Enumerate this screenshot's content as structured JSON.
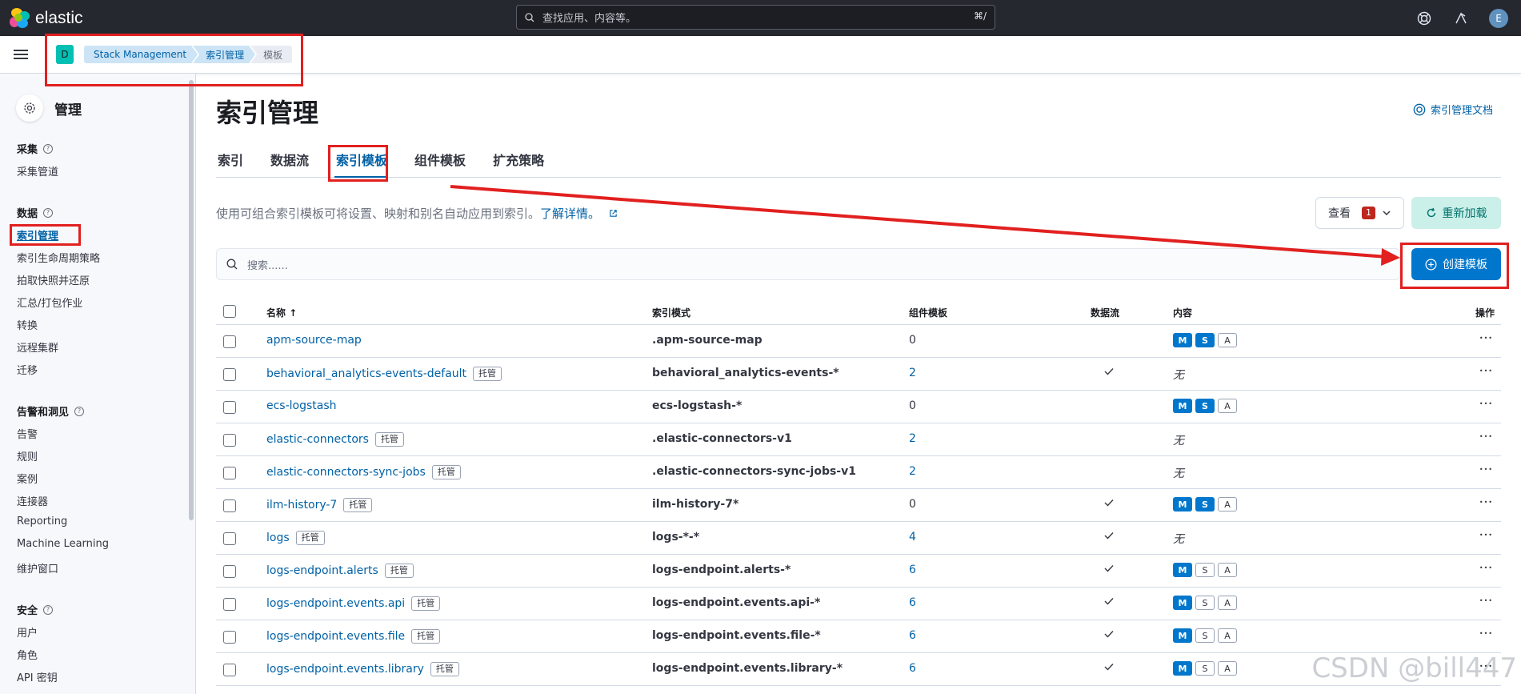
{
  "topbar": {
    "brand": "elastic",
    "search_placeholder": "查找应用、内容等。",
    "search_shortcut": "⌘/",
    "avatar": "E"
  },
  "breadcrumbs": {
    "space": "D",
    "items": [
      "Stack Management",
      "索引管理",
      "模板"
    ]
  },
  "sidebar": {
    "title": "管理",
    "groups": [
      {
        "label": "采集",
        "items": [
          "采集管道"
        ]
      },
      {
        "label": "数据",
        "items": [
          "索引管理",
          "索引生命周期策略",
          "拍取快照并还原",
          "汇总/打包作业",
          "转换",
          "远程集群",
          "迁移"
        ]
      },
      {
        "label": "告警和洞见",
        "items": [
          "告警",
          "规则",
          "案例",
          "连接器",
          "Reporting",
          "Machine Learning",
          "维护窗口"
        ]
      },
      {
        "label": "安全",
        "items": [
          "用户",
          "角色",
          "API 密钥"
        ]
      }
    ],
    "active": "索引管理"
  },
  "main": {
    "title": "索引管理",
    "doc_link": "索引管理文档",
    "tabs": [
      "索引",
      "数据流",
      "索引模板",
      "组件模板",
      "扩充策略"
    ],
    "active_tab": "索引模板",
    "description": "使用可组合索引模板可将设置、映射和别名自动应用到索引。",
    "learn_more": "了解详情。",
    "view_label": "查看",
    "view_count": "1",
    "reload_label": "重新加载",
    "search_placeholder": "搜索......",
    "create_label": "创建模板"
  },
  "table": {
    "headers": [
      "名称",
      "索引模式",
      "组件模板",
      "数据流",
      "内容",
      "操作"
    ],
    "managed_label": "托管",
    "none_label": "无",
    "rows": [
      {
        "name": "apm-source-map",
        "managed": false,
        "pattern": ".apm-source-map",
        "components": "0",
        "datastream": false,
        "content": [
          "M",
          "S",
          "A"
        ],
        "on": [
          true,
          true,
          false
        ]
      },
      {
        "name": "behavioral_analytics-events-default",
        "managed": true,
        "pattern": "behavioral_analytics-events-*",
        "components": "2",
        "datastream": true,
        "content": null
      },
      {
        "name": "ecs-logstash",
        "managed": false,
        "pattern": "ecs-logstash-*",
        "components": "0",
        "datastream": false,
        "content": [
          "M",
          "S",
          "A"
        ],
        "on": [
          true,
          true,
          false
        ]
      },
      {
        "name": "elastic-connectors",
        "managed": true,
        "pattern": ".elastic-connectors-v1",
        "components": "2",
        "datastream": false,
        "content": null
      },
      {
        "name": "elastic-connectors-sync-jobs",
        "managed": true,
        "pattern": ".elastic-connectors-sync-jobs-v1",
        "components": "2",
        "datastream": false,
        "content": null
      },
      {
        "name": "ilm-history-7",
        "managed": true,
        "pattern": "ilm-history-7*",
        "components": "0",
        "datastream": true,
        "content": [
          "M",
          "S",
          "A"
        ],
        "on": [
          true,
          true,
          false
        ]
      },
      {
        "name": "logs",
        "managed": true,
        "pattern": "logs-*-*",
        "components": "4",
        "datastream": true,
        "content": null
      },
      {
        "name": "logs-endpoint.alerts",
        "managed": true,
        "pattern": "logs-endpoint.alerts-*",
        "components": "6",
        "datastream": true,
        "content": [
          "M",
          "S",
          "A"
        ],
        "on": [
          true,
          false,
          false
        ]
      },
      {
        "name": "logs-endpoint.events.api",
        "managed": true,
        "pattern": "logs-endpoint.events.api-*",
        "components": "6",
        "datastream": true,
        "content": [
          "M",
          "S",
          "A"
        ],
        "on": [
          true,
          false,
          false
        ]
      },
      {
        "name": "logs-endpoint.events.file",
        "managed": true,
        "pattern": "logs-endpoint.events.file-*",
        "components": "6",
        "datastream": true,
        "content": [
          "M",
          "S",
          "A"
        ],
        "on": [
          true,
          false,
          false
        ]
      },
      {
        "name": "logs-endpoint.events.library",
        "managed": true,
        "pattern": "logs-endpoint.events.library-*",
        "components": "6",
        "datastream": true,
        "content": [
          "M",
          "S",
          "A"
        ],
        "on": [
          true,
          false,
          false
        ]
      }
    ]
  },
  "watermark": "CSDN @bill447",
  "colors": {
    "accent": "#0077cc",
    "link": "#0061a6",
    "annotation": "#e1201f",
    "header": "#25282f"
  }
}
